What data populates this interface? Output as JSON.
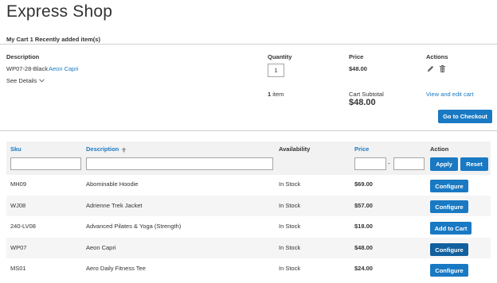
{
  "page": {
    "title": "Express Shop"
  },
  "cart": {
    "heading": "My Cart 1 Recently added item(s)",
    "columns": {
      "description": "Description",
      "quantity": "Quantity",
      "price": "Price",
      "actions": "Actions"
    },
    "item": {
      "sku": "WP07-28-Black",
      "name": "Aeon Capri",
      "see_details": "See Details",
      "qty": "1",
      "price": "$48.00"
    },
    "items_count_num": "1",
    "items_count_label": "item",
    "subtotal_label": "Cart Subtotal",
    "subtotal_value": "$48.00",
    "view_edit_label": "View and edit cart",
    "checkout_label": "Go to Checkout",
    "icons": {
      "edit": "pencil-icon",
      "delete": "trash-icon"
    }
  },
  "grid": {
    "columns": {
      "sku": "Sku",
      "description": "Description",
      "availability": "Availability",
      "price": "Price",
      "action": "Action"
    },
    "apply_label": "Apply",
    "reset_label": "Reset",
    "price_range_separator": "-",
    "filters": {
      "sku": "",
      "description": "",
      "price_from": "",
      "price_to": ""
    },
    "rows": [
      {
        "sku": "MH09",
        "name": "Abominable Hoodie",
        "availability": "In Stock",
        "price": "$69.00",
        "action": "Configure"
      },
      {
        "sku": "WJ08",
        "name": "Adrienne Trek Jacket",
        "availability": "In Stock",
        "price": "$57.00",
        "action": "Configure"
      },
      {
        "sku": "240-LV08",
        "name": "Advanced Pilates & Yoga (Strength)",
        "availability": "In Stock",
        "price": "$18.00",
        "action": "Add to Cart"
      },
      {
        "sku": "WP07",
        "name": "Aeon Capri",
        "availability": "In Stock",
        "price": "$48.00",
        "action": "Configure"
      },
      {
        "sku": "MS01",
        "name": "Aero Daily Fitness Tee",
        "availability": "In Stock",
        "price": "$24.00",
        "action": "Configure"
      }
    ]
  },
  "colors": {
    "accent": "#1979c3",
    "text": "#333333",
    "row_alt": "#f5f5f5",
    "header_bg": "#f2f2f2"
  }
}
